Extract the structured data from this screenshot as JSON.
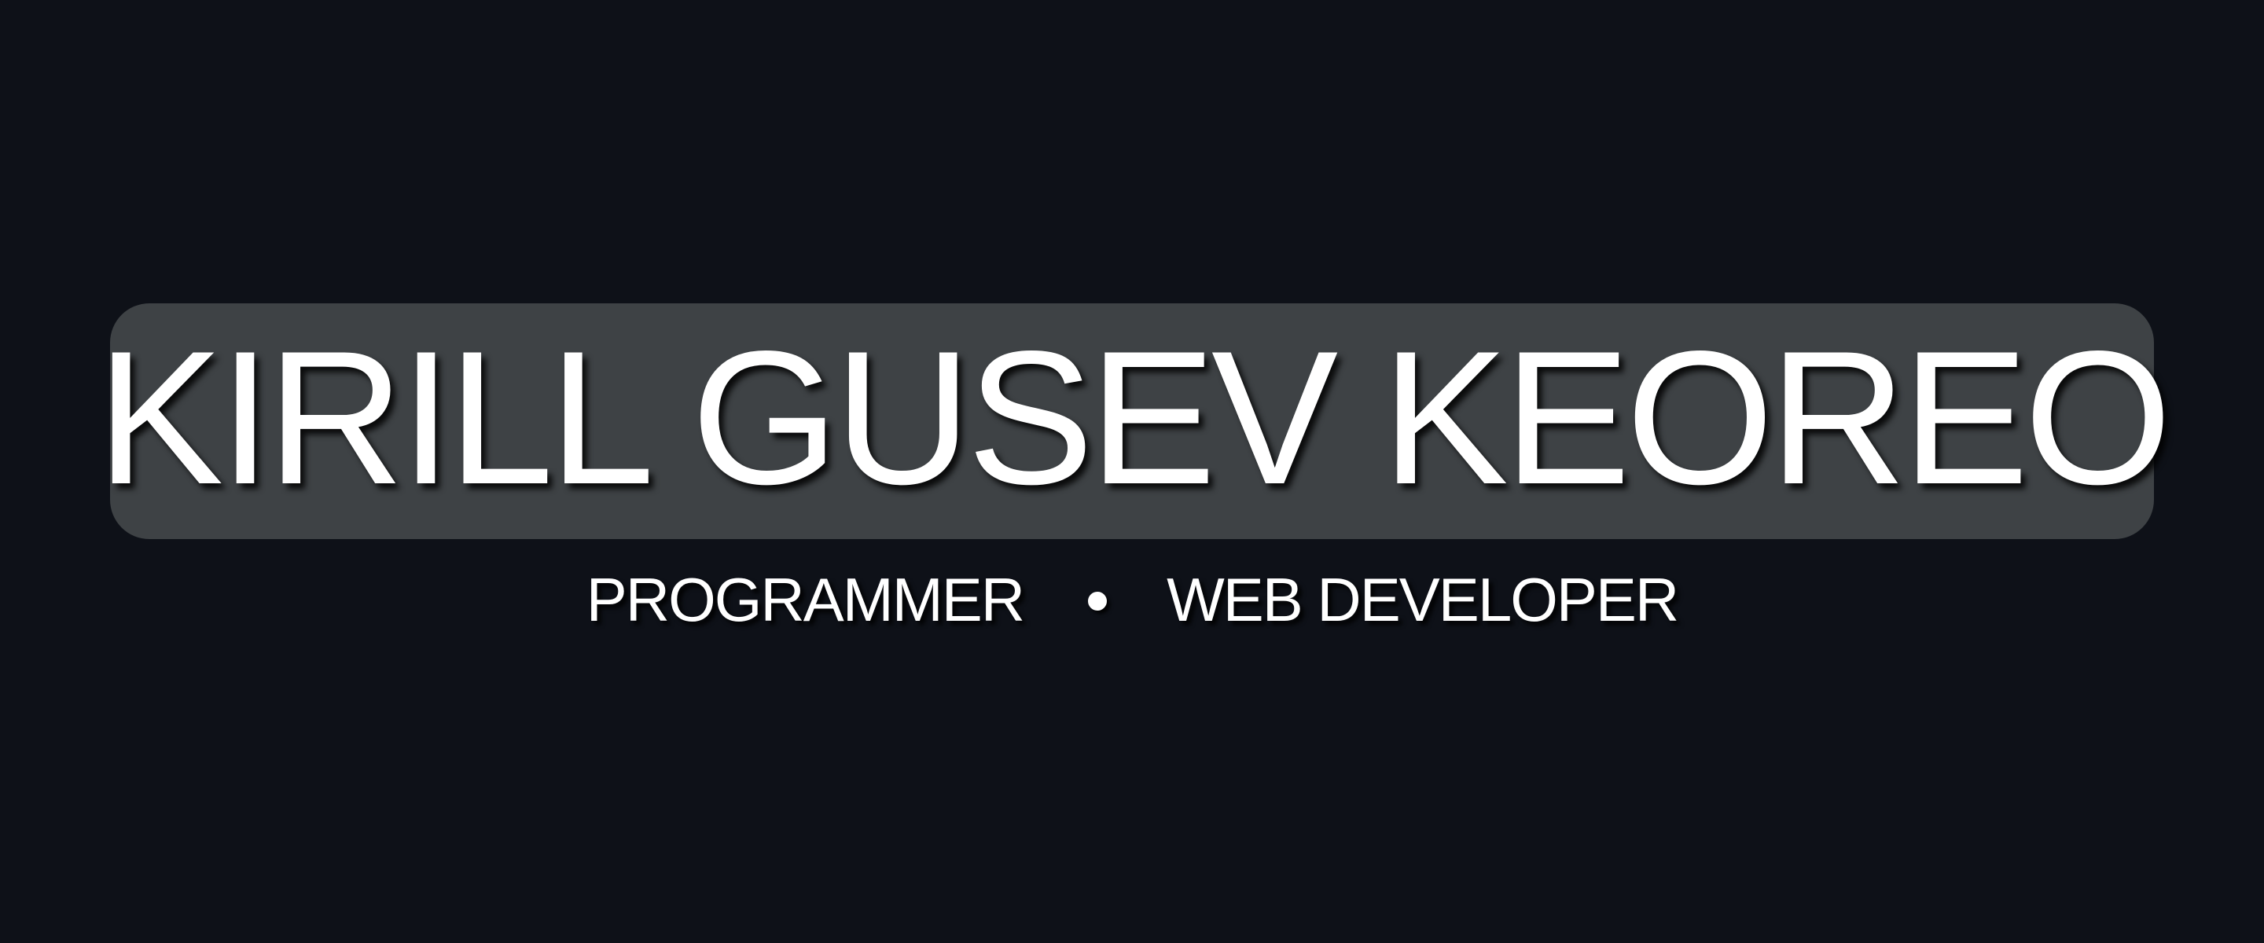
{
  "banner": {
    "name": "KIRILL GUSEV KEOREO",
    "roles": [
      "PROGRAMMER",
      "WEB DEVELOPER"
    ],
    "separator_icon": "bullet-dot",
    "colors": {
      "background": "#0e1118",
      "pill": "#3e4245",
      "text": "#ffffff"
    }
  }
}
